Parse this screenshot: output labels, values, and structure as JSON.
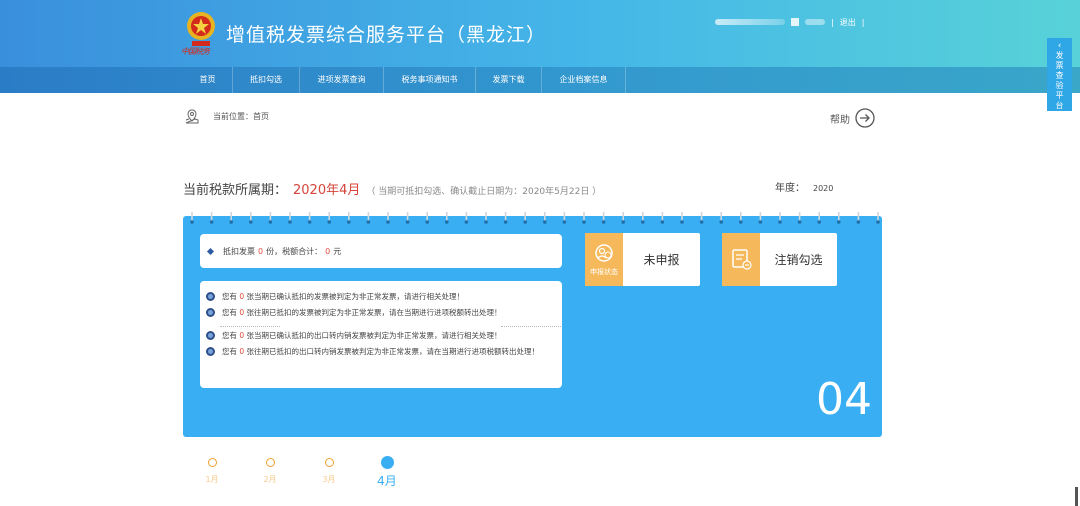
{
  "header": {
    "logo_caption": "中国税务",
    "title": "增值税发票综合服务平台（黑龙江）",
    "logout": "退出"
  },
  "nav": {
    "items": [
      "首页",
      "抵扣勾选",
      "进项发票查询",
      "税务事项通知书",
      "发票下载",
      "企业档案信息"
    ]
  },
  "side_tab": {
    "label": "发票查验平台"
  },
  "breadcrumb": {
    "text": "当前位置：首页"
  },
  "help": {
    "label": "帮助"
  },
  "period": {
    "label": "当前税款所属期：",
    "value": "2020年4月",
    "note": "（ 当期可抵扣勾选、确认截止日期为：2020年5月22日 ）"
  },
  "year": {
    "label": "年度：",
    "value": "2020"
  },
  "summary": {
    "prefix": "抵扣发票",
    "count": "0",
    "mid": "份，税额合计：",
    "amount": "0",
    "suffix": "元"
  },
  "messages": [
    {
      "pre": "您有",
      "num": "0",
      "post": "张当期已确认抵扣的发票被判定为非正常发票，请进行相关处理！"
    },
    {
      "pre": "您有",
      "num": "0",
      "post": "张往期已抵扣的发票被判定为非正常发票，请在当期进行进项税额转出处理！"
    },
    {
      "pre": "您有",
      "num": "0",
      "post": "张当期已确认抵扣的出口转内销发票被判定为非正常发票，请进行相关处理！"
    },
    {
      "pre": "您有",
      "num": "0",
      "post": "张往期已抵扣的出口转内销发票被判定为非正常发票，请在当期进行进项税额转出处理！"
    }
  ],
  "declare_card": {
    "icon_caption": "申报状态",
    "label": "未申报"
  },
  "cancel_card": {
    "label": "注销勾选"
  },
  "month_big": "04",
  "timeline": [
    {
      "label": "1月",
      "active": false
    },
    {
      "label": "2月",
      "active": false
    },
    {
      "label": "3月",
      "active": false
    },
    {
      "label": "4月",
      "active": true
    }
  ],
  "colors": {
    "header_start": "#3a8fdc",
    "header_end": "#58d2d8",
    "panel": "#3aaef3",
    "accent_orange": "#f5b85a",
    "alert_red": "#e24a3c"
  }
}
